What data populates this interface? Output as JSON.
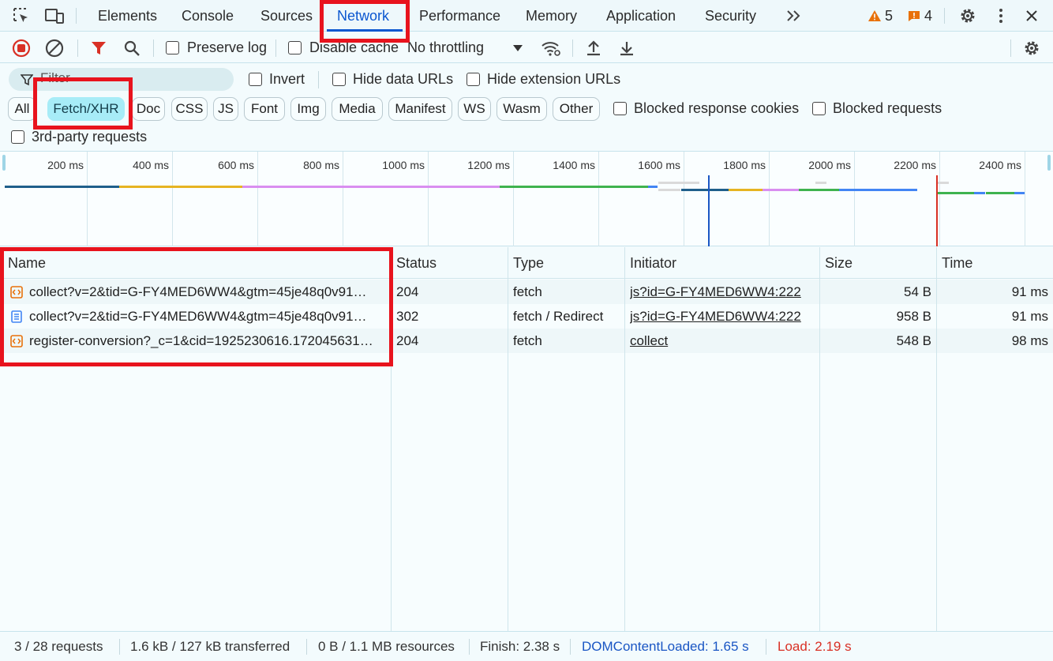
{
  "tabs": [
    "Elements",
    "Console",
    "Sources",
    "Network",
    "Performance",
    "Memory",
    "Application",
    "Security"
  ],
  "active_tab": "Network",
  "badges": {
    "warnings": "5",
    "issues": "4"
  },
  "toolbar": {
    "preserve_log": "Preserve log",
    "disable_cache": "Disable cache",
    "throttling": "No throttling"
  },
  "filter": {
    "placeholder": "Filter",
    "invert": "Invert",
    "hide_data_urls": "Hide data URLs",
    "hide_extension_urls": "Hide extension URLs"
  },
  "types": [
    "All",
    "Fetch/XHR",
    "Doc",
    "CSS",
    "JS",
    "Font",
    "Img",
    "Media",
    "Manifest",
    "WS",
    "Wasm",
    "Other"
  ],
  "active_type": "Fetch/XHR",
  "blocked_response_cookies": "Blocked response cookies",
  "blocked_requests": "Blocked requests",
  "third_party": "3rd-party requests",
  "timeline_ticks": [
    "200 ms",
    "400 ms",
    "600 ms",
    "800 ms",
    "1000 ms",
    "1200 ms",
    "1400 ms",
    "1600 ms",
    "1800 ms",
    "2000 ms",
    "2200 ms",
    "2400 ms"
  ],
  "columns": [
    "Name",
    "Status",
    "Type",
    "Initiator",
    "Size",
    "Time"
  ],
  "rows": [
    {
      "icon": "xhr-icon",
      "name": "collect?v=2&tid=G-FY4MED6WW4&gtm=45je48q0v91…",
      "status": "204",
      "type": "fetch",
      "initiator": "js?id=G-FY4MED6WW4:222",
      "size": "54 B",
      "time": "91 ms"
    },
    {
      "icon": "document-icon",
      "name": "collect?v=2&tid=G-FY4MED6WW4&gtm=45je48q0v91…",
      "status": "302",
      "type": "fetch / Redirect",
      "initiator": "js?id=G-FY4MED6WW4:222",
      "size": "958 B",
      "time": "91 ms"
    },
    {
      "icon": "xhr-icon",
      "name": "register-conversion?_c=1&cid=1925230616.172045631…",
      "status": "204",
      "type": "fetch",
      "initiator": "collect",
      "size": "548 B",
      "time": "98 ms"
    }
  ],
  "status": {
    "requests": "3 / 28 requests",
    "transferred": "1.6 kB / 127 kB transferred",
    "resources": "0 B / 1.1 MB resources",
    "finish": "Finish: 2.38 s",
    "dcl": "DOMContentLoaded: 1.65 s",
    "load": "Load: 2.19 s"
  },
  "colors": {
    "accent": "#0b57d0",
    "highlight": "#e8131d",
    "dcl": "#1a56c4",
    "load": "#d93025"
  }
}
